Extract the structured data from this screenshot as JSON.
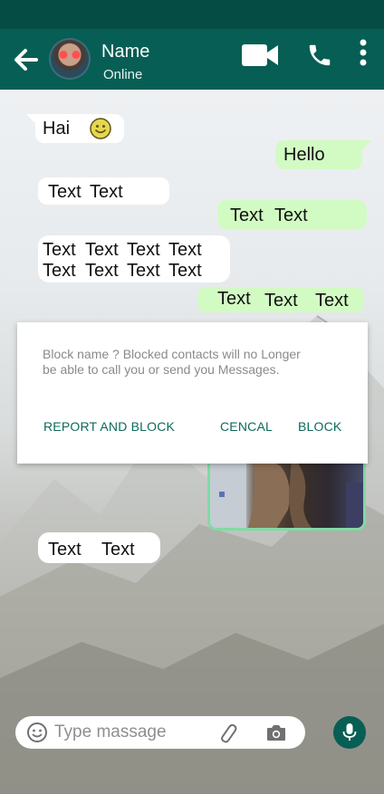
{
  "header": {
    "contact_name": "Name",
    "status": "Online"
  },
  "icons": {
    "back": "back-arrow-icon",
    "video": "video-call-icon",
    "call": "phone-icon",
    "menu": "more-vert-icon",
    "emoji_reaction": "smiley-icon",
    "emoji_picker": "emoji-icon",
    "attach": "paperclip-icon",
    "camera": "camera-icon",
    "mic": "microphone-icon"
  },
  "messages": {
    "m1": {
      "text": "Hai"
    },
    "m2": {
      "text": "Hello"
    },
    "m3": {
      "w1": "Text",
      "w2": "Text"
    },
    "m4": {
      "w1": "Text",
      "w2": "Text"
    },
    "m5": {
      "line1": [
        "Text",
        "Text",
        "Text",
        "Text"
      ],
      "line2": [
        "Text",
        "Text",
        "Text",
        "Text"
      ]
    },
    "m6": {
      "w1": "Text",
      "w2": "Text",
      "w3": "Text"
    },
    "m7": {
      "w1": "Text",
      "w2": "Text"
    }
  },
  "dialog": {
    "message": "Block name ? Blocked contacts will no Longer be able to call you or send you Messages.",
    "report_block": "REPORT AND BLOCK",
    "cancel": "CENCAL",
    "block": "BLOCK"
  },
  "composer": {
    "placeholder": "Type massage"
  },
  "colors": {
    "primary": "#075e54",
    "status_bar": "#054d44",
    "outgoing_bubble": "#d2fbc3",
    "incoming_bubble": "#ffffff",
    "dialog_button": "#0e6a5c"
  }
}
